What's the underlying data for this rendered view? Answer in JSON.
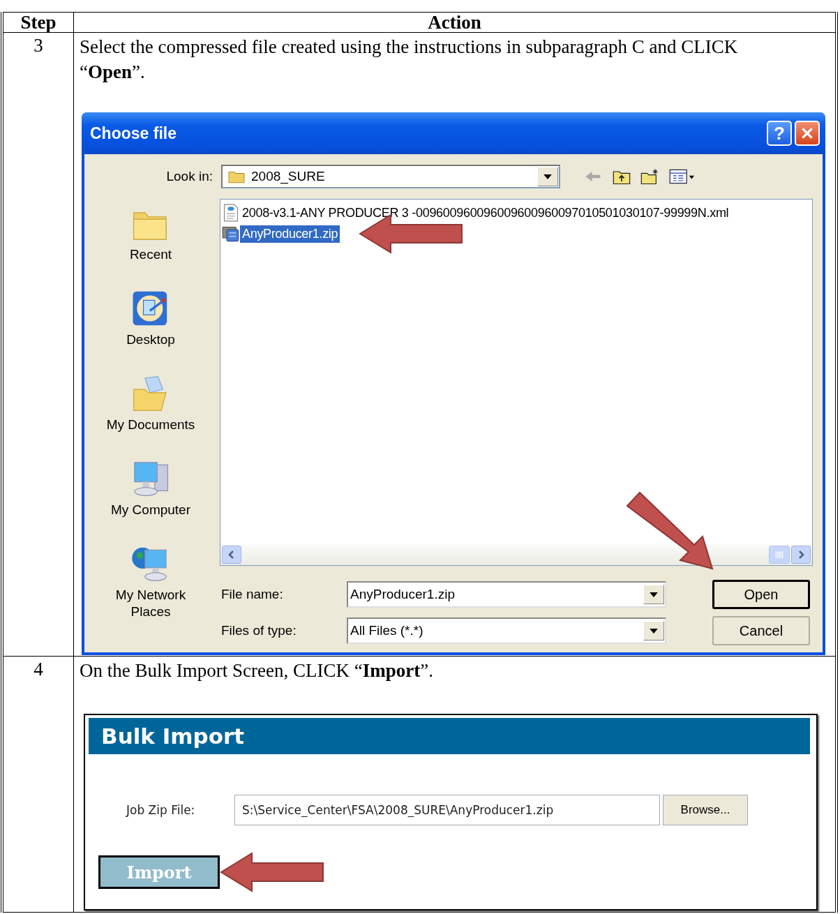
{
  "table": {
    "columns": [
      "Step",
      "Action"
    ],
    "rows": [
      {
        "step": "3",
        "instruction": "Select the compressed file created using the instructions in subparagraph C and CLICK “**Open**”.",
        "screen": {
          "kind": "dialog",
          "title": "Choose file",
          "help_button": "?",
          "look_in": {
            "label": "Look in:",
            "value": "2008_SURE"
          },
          "places": [
            {
              "kind": "recent",
              "label": "Recent"
            },
            {
              "kind": "desktop",
              "label": "Desktop"
            },
            {
              "kind": "documents",
              "label": "My Documents"
            },
            {
              "kind": "computer",
              "label": "My Computer"
            },
            {
              "kind": "network",
              "label": "My Network Places"
            }
          ],
          "files": [
            {
              "kind": "xml",
              "name": "2008-v3.1-ANY PRODUCER 3 -009600960096009600960097010501030107-99999N.xml",
              "selected": false
            },
            {
              "kind": "zip",
              "name": "AnyProducer1.zip",
              "selected": true
            }
          ],
          "file_name": {
            "label": "File name:",
            "value": "AnyProducer1.zip"
          },
          "file_type": {
            "label": "Files of type:",
            "value": "All Files (*.*)"
          },
          "buttons": [
            {
              "label": "Open",
              "default": true
            },
            {
              "label": "Cancel",
              "default": false
            }
          ]
        }
      },
      {
        "step": "4",
        "instruction": "On the Bulk Import Screen, CLICK “**Import**”.",
        "screen": {
          "kind": "web",
          "title": "Bulk Import",
          "field": {
            "label": "Job Zip File:",
            "value": "S:\\Service_Center\\FSA\\2008_SURE\\AnyProducer1.zip"
          },
          "browse": "Browse...",
          "submit": "Import"
        }
      }
    ]
  }
}
